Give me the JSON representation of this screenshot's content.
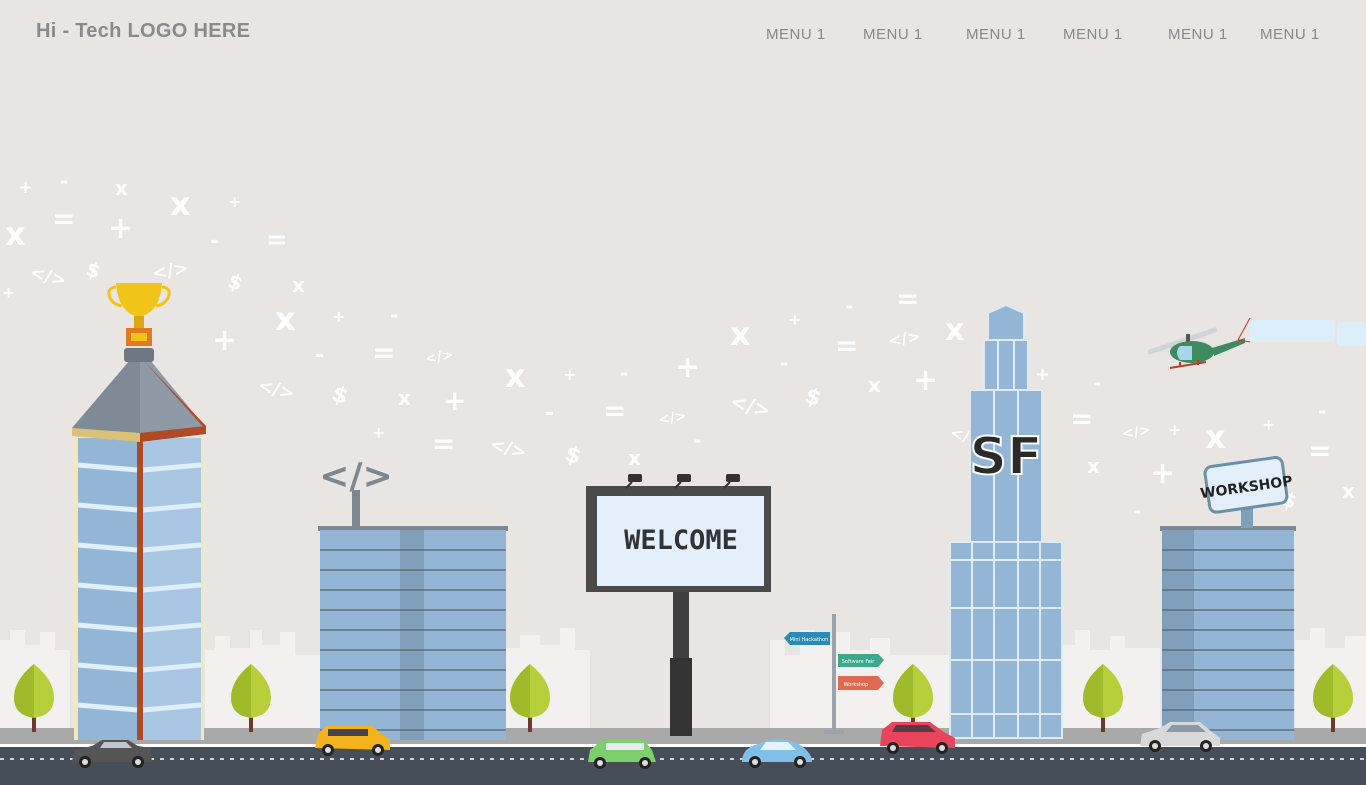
{
  "header": {
    "logo": "Hi - Tech LOGO HERE",
    "menu": [
      "MENU 1",
      "MENU 1",
      "MENU 1",
      "MENU 1",
      "MENU 1",
      "MENU 1"
    ]
  },
  "scene": {
    "billboard": "WELCOME",
    "tower_logo": "SF",
    "workshop_sign": "WORKSHOP",
    "signpost": [
      "Mini Hackathon",
      "Software Fair",
      "Workshop"
    ],
    "code_sign": "</>"
  },
  "colors": {
    "background": "#e8e5e2",
    "road": "#464f58",
    "building_blue": "#93b6d6",
    "tree": "#b7cf3a",
    "trophy": "#f0c419"
  }
}
